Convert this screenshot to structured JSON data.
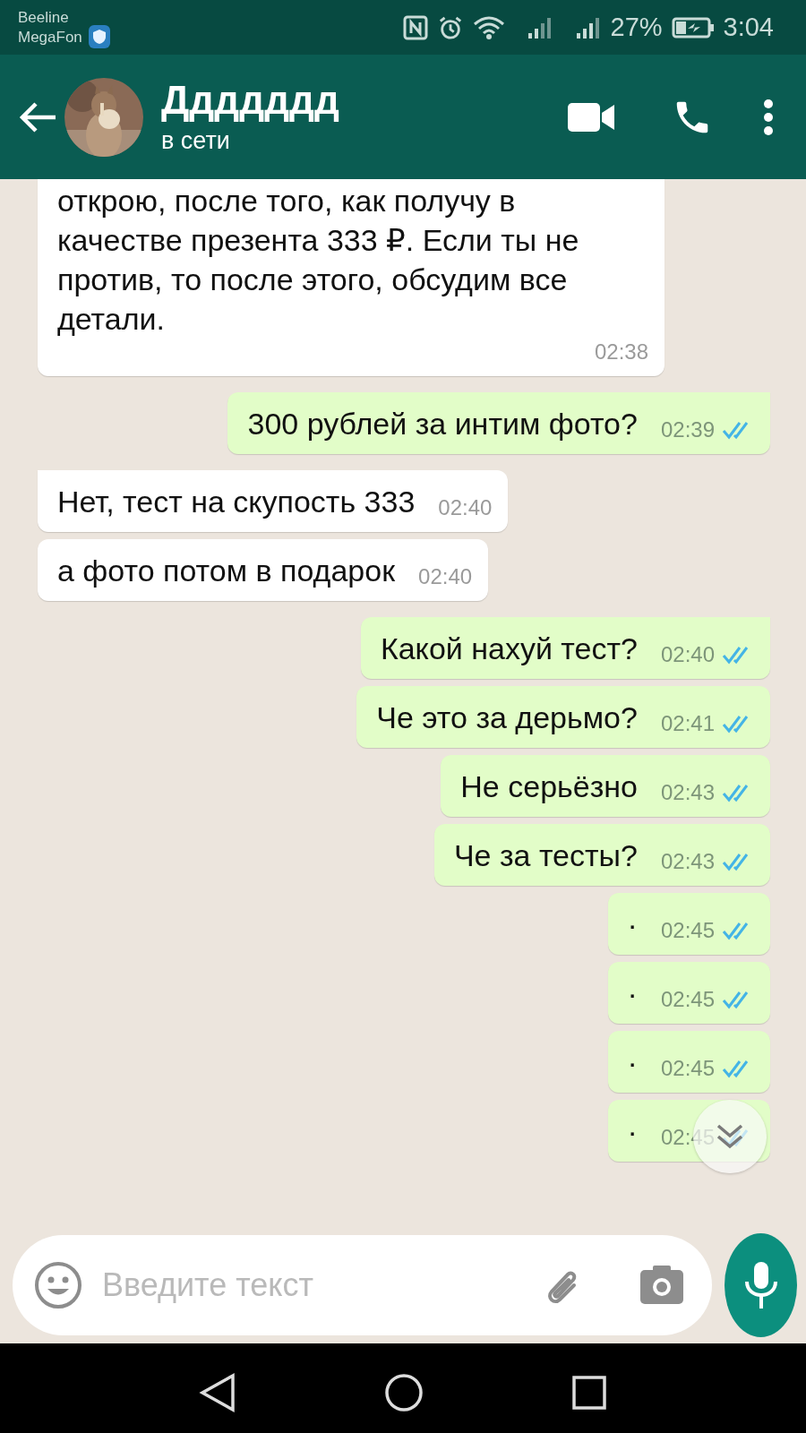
{
  "status_bar": {
    "carriers": [
      "Beeline",
      "MegaFon"
    ],
    "battery": "27%",
    "time": "3:04"
  },
  "header": {
    "name": "Ддддддд",
    "status": "в сети"
  },
  "messages": [
    {
      "kind": "in",
      "text": "открою, после того, как получу в качестве презента 333 ₽. Если ты не против, то после этого, обсудим все детали.",
      "time": "02:38"
    },
    {
      "kind": "out",
      "text": "300 рублей за интим фото?",
      "time": "02:39",
      "read": true
    },
    {
      "kind": "in",
      "text": "Нет, тест на скупость 333",
      "time": "02:40"
    },
    {
      "kind": "in",
      "text": "а фото потом в подарок",
      "time": "02:40"
    },
    {
      "kind": "out",
      "text": "Какой нахуй тест?",
      "time": "02:40",
      "read": true
    },
    {
      "kind": "out",
      "text": "Че это за дерьмо?",
      "time": "02:41",
      "read": true
    },
    {
      "kind": "out",
      "text": "Не серьёзно",
      "time": "02:43",
      "read": true
    },
    {
      "kind": "out",
      "text": "Че за тесты?",
      "time": "02:43",
      "read": true
    },
    {
      "kind": "out",
      "text": "·",
      "time": "02:45",
      "read": true
    },
    {
      "kind": "out",
      "text": "·",
      "time": "02:45",
      "read": true
    },
    {
      "kind": "out",
      "text": "·",
      "time": "02:45",
      "read": true
    },
    {
      "kind": "out",
      "text": "·",
      "time": "02:45",
      "read": true
    }
  ],
  "composer": {
    "placeholder": "Введите текст"
  }
}
